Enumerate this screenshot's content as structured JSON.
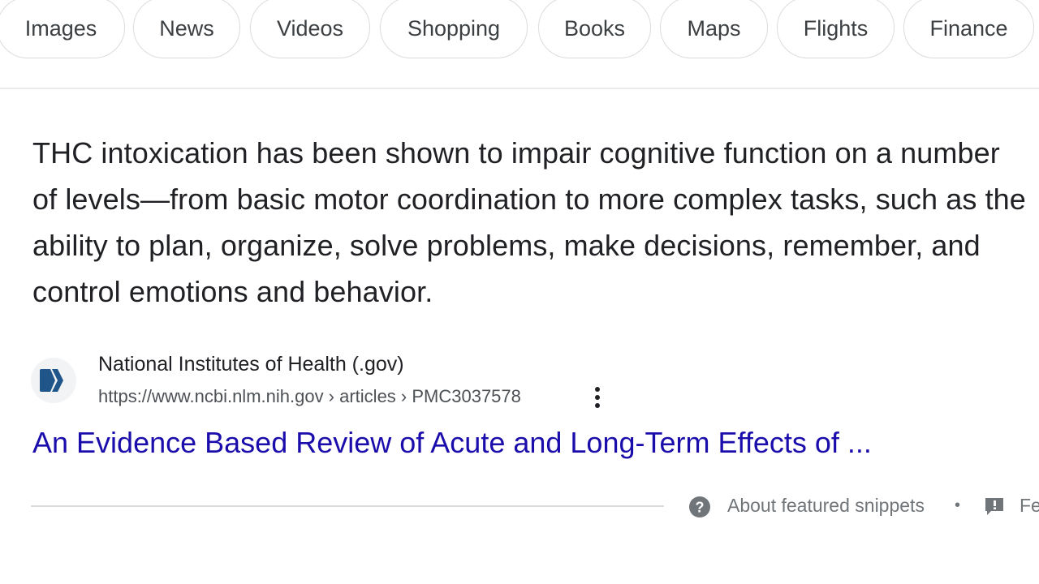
{
  "filters": {
    "images": "Images",
    "news": "News",
    "videos": "Videos",
    "shopping": "Shopping",
    "books": "Books",
    "maps": "Maps",
    "flights": "Flights",
    "finance": "Finance"
  },
  "snippet": {
    "text": "THC intoxication has been shown to impair cognitive function on a number of levels—from basic motor coordination to more complex tasks, such as the ability to plan, organize, solve problems, make decisions, remember, and control emotions and behavior."
  },
  "source": {
    "favicon": "nih-logo-icon",
    "name": "National Institutes of Health (.gov)",
    "url": "https://www.ncbi.nlm.nih.gov › articles › PMC3037578",
    "more_icon": "three-dots-vertical-icon"
  },
  "result": {
    "title": "An Evidence Based Review of Acute and Long-Term Effects of ..."
  },
  "footer": {
    "help_icon": "question-circle-icon",
    "about_label": "About featured snippets",
    "separator": "•",
    "feedback_icon": "feedback-icon",
    "feedback_label": "Fe"
  },
  "colors": {
    "link": "#1a0dab",
    "text": "#202124",
    "muted": "#70757a",
    "border": "#dadce0"
  }
}
